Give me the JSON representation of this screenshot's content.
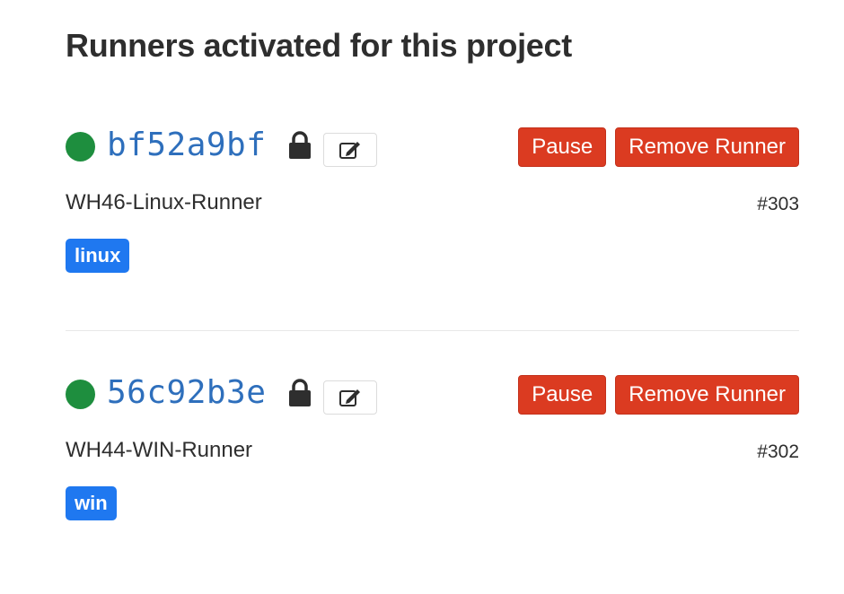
{
  "page": {
    "title": "Runners activated for this project"
  },
  "colors": {
    "status_online": "#1e8e3e",
    "token": "#2e6fbc",
    "danger": "#db3b21",
    "tag": "#1f78f0"
  },
  "runners": [
    {
      "token": "bf52a9bf",
      "name": "WH46-Linux-Runner",
      "id": "#303",
      "status": "online",
      "locked": true,
      "tags": [
        "linux"
      ],
      "pause_label": "Pause",
      "remove_label": "Remove Runner"
    },
    {
      "token": "56c92b3e",
      "name": "WH44-WIN-Runner",
      "id": "#302",
      "status": "online",
      "locked": true,
      "tags": [
        "win"
      ],
      "pause_label": "Pause",
      "remove_label": "Remove Runner"
    }
  ]
}
